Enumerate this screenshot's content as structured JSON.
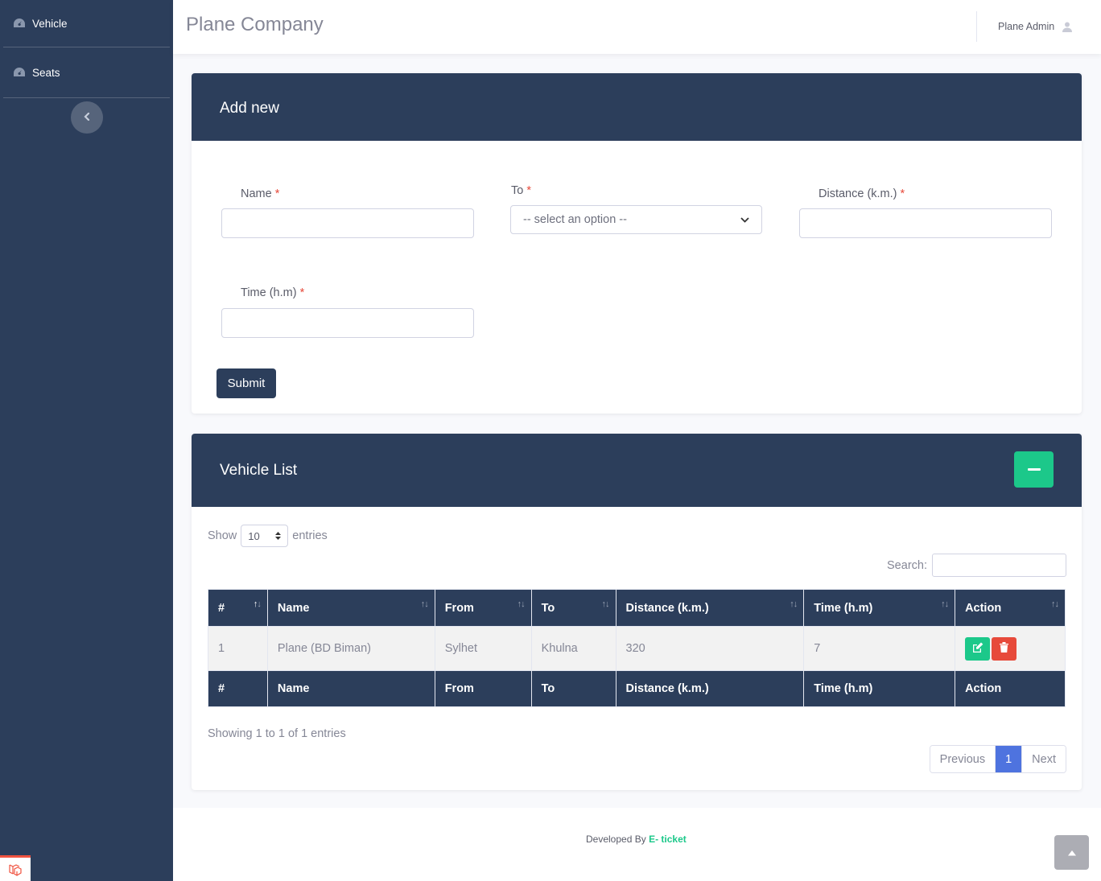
{
  "sidebar": {
    "items": [
      {
        "label": "Vehicle",
        "icon": "tachometer-icon"
      },
      {
        "label": "Seats",
        "icon": "tachometer-icon"
      }
    ],
    "toggle_icon": "chevron-left-icon"
  },
  "topbar": {
    "brand": "Plane Company",
    "user_name": "Plane Admin",
    "user_icon": "user-icon"
  },
  "add_form": {
    "title": "Add new",
    "name_label": "Name",
    "to_label": "To",
    "to_selected": "-- select an option --",
    "distance_label": "Distance (k.m.)",
    "time_label": "Time (h.m)",
    "required_mark": "*",
    "submit_label": "Submit"
  },
  "vehicle_list": {
    "title": "Vehicle List",
    "show_label": "Show",
    "entries_label": "entries",
    "page_length": "10",
    "search_label": "Search:",
    "columns": [
      "#",
      "Name",
      "From",
      "To",
      "Distance (k.m.)",
      "Time (h.m)",
      "Action"
    ],
    "rows": [
      {
        "num": "1",
        "name": "Plane (BD Biman)",
        "from": "Sylhet",
        "to": "Khulna",
        "distance": "320",
        "time": "7"
      }
    ],
    "info": "Showing 1 to 1 of 1 entries",
    "pagination": {
      "previous": "Previous",
      "current": "1",
      "next": "Next"
    }
  },
  "footer": {
    "text": "Developed By",
    "brand": "E- ticket"
  },
  "colors": {
    "primary_dark": "#2c3e5b",
    "success": "#1cc88a",
    "danger": "#e74a3b",
    "active_page": "#4e73df"
  }
}
